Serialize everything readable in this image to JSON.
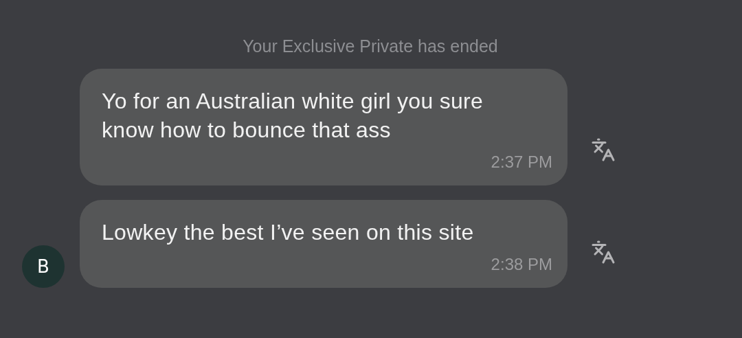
{
  "system_notice": "Your Exclusive Private has ended",
  "messages": [
    {
      "text": "Yo for an Australian white girl you sure know how to bounce that ass",
      "time": "2:37 PM"
    },
    {
      "text": "Lowkey the best I’ve seen on this site",
      "time": "2:38 PM",
      "avatar": "B"
    }
  ]
}
